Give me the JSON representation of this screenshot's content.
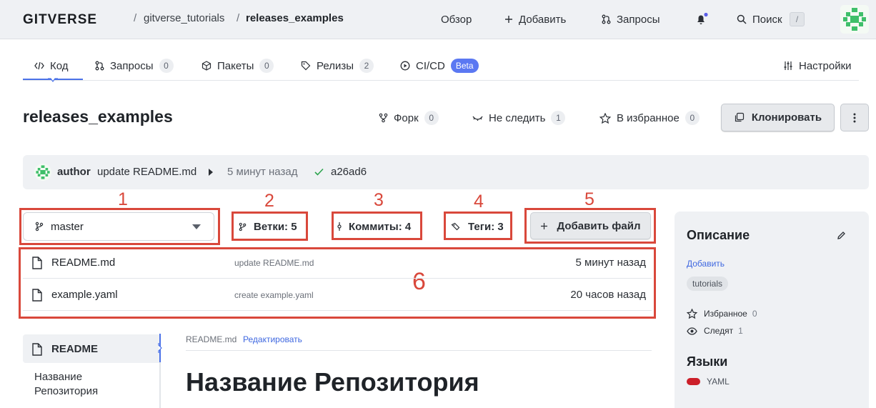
{
  "header": {
    "logo_text": "GITVERSE",
    "breadcrumb": {
      "owner": "gitverse_tutorials",
      "separator": "/",
      "repo": "releases_examples"
    },
    "nav": {
      "overview": "Обзор",
      "add": "Добавить",
      "requests": "Запросы",
      "search": "Поиск",
      "search_shortcut": "/"
    }
  },
  "tabs": [
    {
      "label": "Код",
      "icon": "code-icon"
    },
    {
      "label": "Запросы",
      "count": "0",
      "icon": "pull-request-icon"
    },
    {
      "label": "Пакеты",
      "count": "0",
      "icon": "package-icon"
    },
    {
      "label": "Релизы",
      "count": "2",
      "icon": "tag-icon"
    },
    {
      "label": "CI/CD",
      "badge": "Beta",
      "icon": "play-circle-icon"
    }
  ],
  "settings_label": "Настройки",
  "repo": {
    "title": "releases_examples",
    "fork": {
      "label": "Форк",
      "count": "0"
    },
    "watch": {
      "label": "Не следить",
      "count": "1"
    },
    "star": {
      "label": "В избранное",
      "count": "0"
    },
    "clone_label": "Клонировать"
  },
  "commit": {
    "author": "author",
    "message": "update README.md",
    "time": "5 минут назад",
    "hash": "a26ad6"
  },
  "annotations": [
    "1",
    "2",
    "3",
    "4",
    "5",
    "6"
  ],
  "controls": {
    "branch": "master",
    "branches": "Ветки: 5",
    "commits": "Коммиты: 4",
    "tags": "Теги: 3",
    "add_file": "Добавить файл"
  },
  "files": [
    {
      "name": "README.md",
      "message": "update README.md",
      "time": "5 минут назад"
    },
    {
      "name": "example.yaml",
      "message": "create example.yaml",
      "time": "20 часов назад"
    }
  ],
  "readme": {
    "toc_active": "README",
    "toc_item": "Название Репозитория",
    "path": "README.md",
    "edit": "Редактировать",
    "heading": "Название Репозитория"
  },
  "sidebar": {
    "description_title": "Описание",
    "add": "Добавить",
    "topic": "tutorials",
    "favorites": {
      "label": "Избранное",
      "count": "0"
    },
    "watchers": {
      "label": "Следят",
      "count": "1"
    },
    "languages_title": "Языки",
    "language": {
      "name": "YAML",
      "color": "#cc1f29"
    }
  },
  "colors": {
    "accent": "#4b72e8",
    "annotation": "#d9483b",
    "beta": "#5b78f2",
    "notify_dot": "#5b5ee8",
    "check": "#2da44e"
  }
}
